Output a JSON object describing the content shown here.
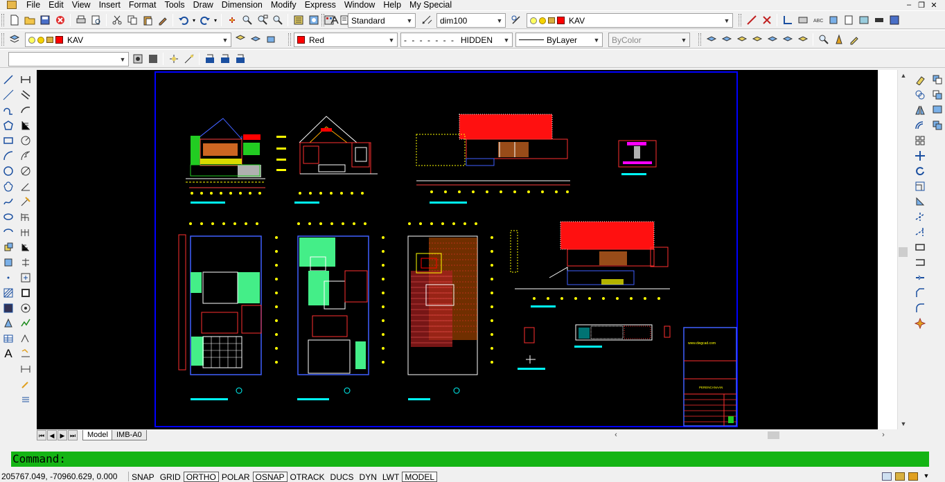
{
  "menubar": {
    "items": [
      "File",
      "Edit",
      "View",
      "Insert",
      "Format",
      "Tools",
      "Draw",
      "Dimension",
      "Modify",
      "Express",
      "Window",
      "Help",
      "My Special"
    ]
  },
  "toolbar": {
    "text_style": "Standard",
    "dim_style": "dim100",
    "layer_top": "KAV",
    "layer": "KAV",
    "color": "Red",
    "linetype": "HIDDEN",
    "lineweight": "ByLayer",
    "plotstyle": "ByColor"
  },
  "colors": {
    "drawing_bg": "#000000",
    "command_bg": "#14b414",
    "layer_red": "#ff0000",
    "sheet_border": "#0000ff"
  },
  "tabs": [
    {
      "label": "Model",
      "active": true
    },
    {
      "label": "IMB-A0",
      "active": false
    }
  ],
  "command": {
    "prompt": "Command:"
  },
  "status": {
    "coords": "205767.049, -70960.629, 0.000",
    "buttons": [
      {
        "label": "SNAP",
        "on": false
      },
      {
        "label": "GRID",
        "on": false
      },
      {
        "label": "ORTHO",
        "on": true
      },
      {
        "label": "POLAR",
        "on": false
      },
      {
        "label": "OSNAP",
        "on": true
      },
      {
        "label": "OTRACK",
        "on": false
      },
      {
        "label": "DUCS",
        "on": false
      },
      {
        "label": "DYN",
        "on": false
      },
      {
        "label": "LWT",
        "on": false
      },
      {
        "label": "MODEL",
        "on": true
      }
    ]
  },
  "drawing": {
    "title_block_texts": [
      "www.dwgcad.com",
      "PERENCANAAN"
    ]
  }
}
